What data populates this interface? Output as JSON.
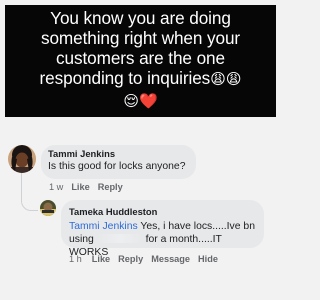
{
  "post": {
    "caption_lines": [
      "You know you are doing",
      "something right when your",
      "customers are the one",
      "responding to inquiries"
    ],
    "caption_emoji_1": "😩😩",
    "caption_emoji_2": "😌",
    "caption_emoji_3": "❤️"
  },
  "comments": [
    {
      "author": "Tammi Jenkins",
      "text": "Is this good for locks anyone?",
      "time": "1 w",
      "like_label": "Like",
      "reply_label": "Reply"
    }
  ],
  "reply": {
    "author": "Tameka Huddleston",
    "mention": "Tammi Jenkins",
    "text_part1": " Yes, i have locs.....Ive bn",
    "text_part2_pre": "using",
    "text_part2_post": "for a month.....IT WORKS",
    "time": "1 h",
    "like_label": "Like",
    "reply_label": "Reply",
    "message_label": "Message",
    "hide_label": "Hide"
  }
}
